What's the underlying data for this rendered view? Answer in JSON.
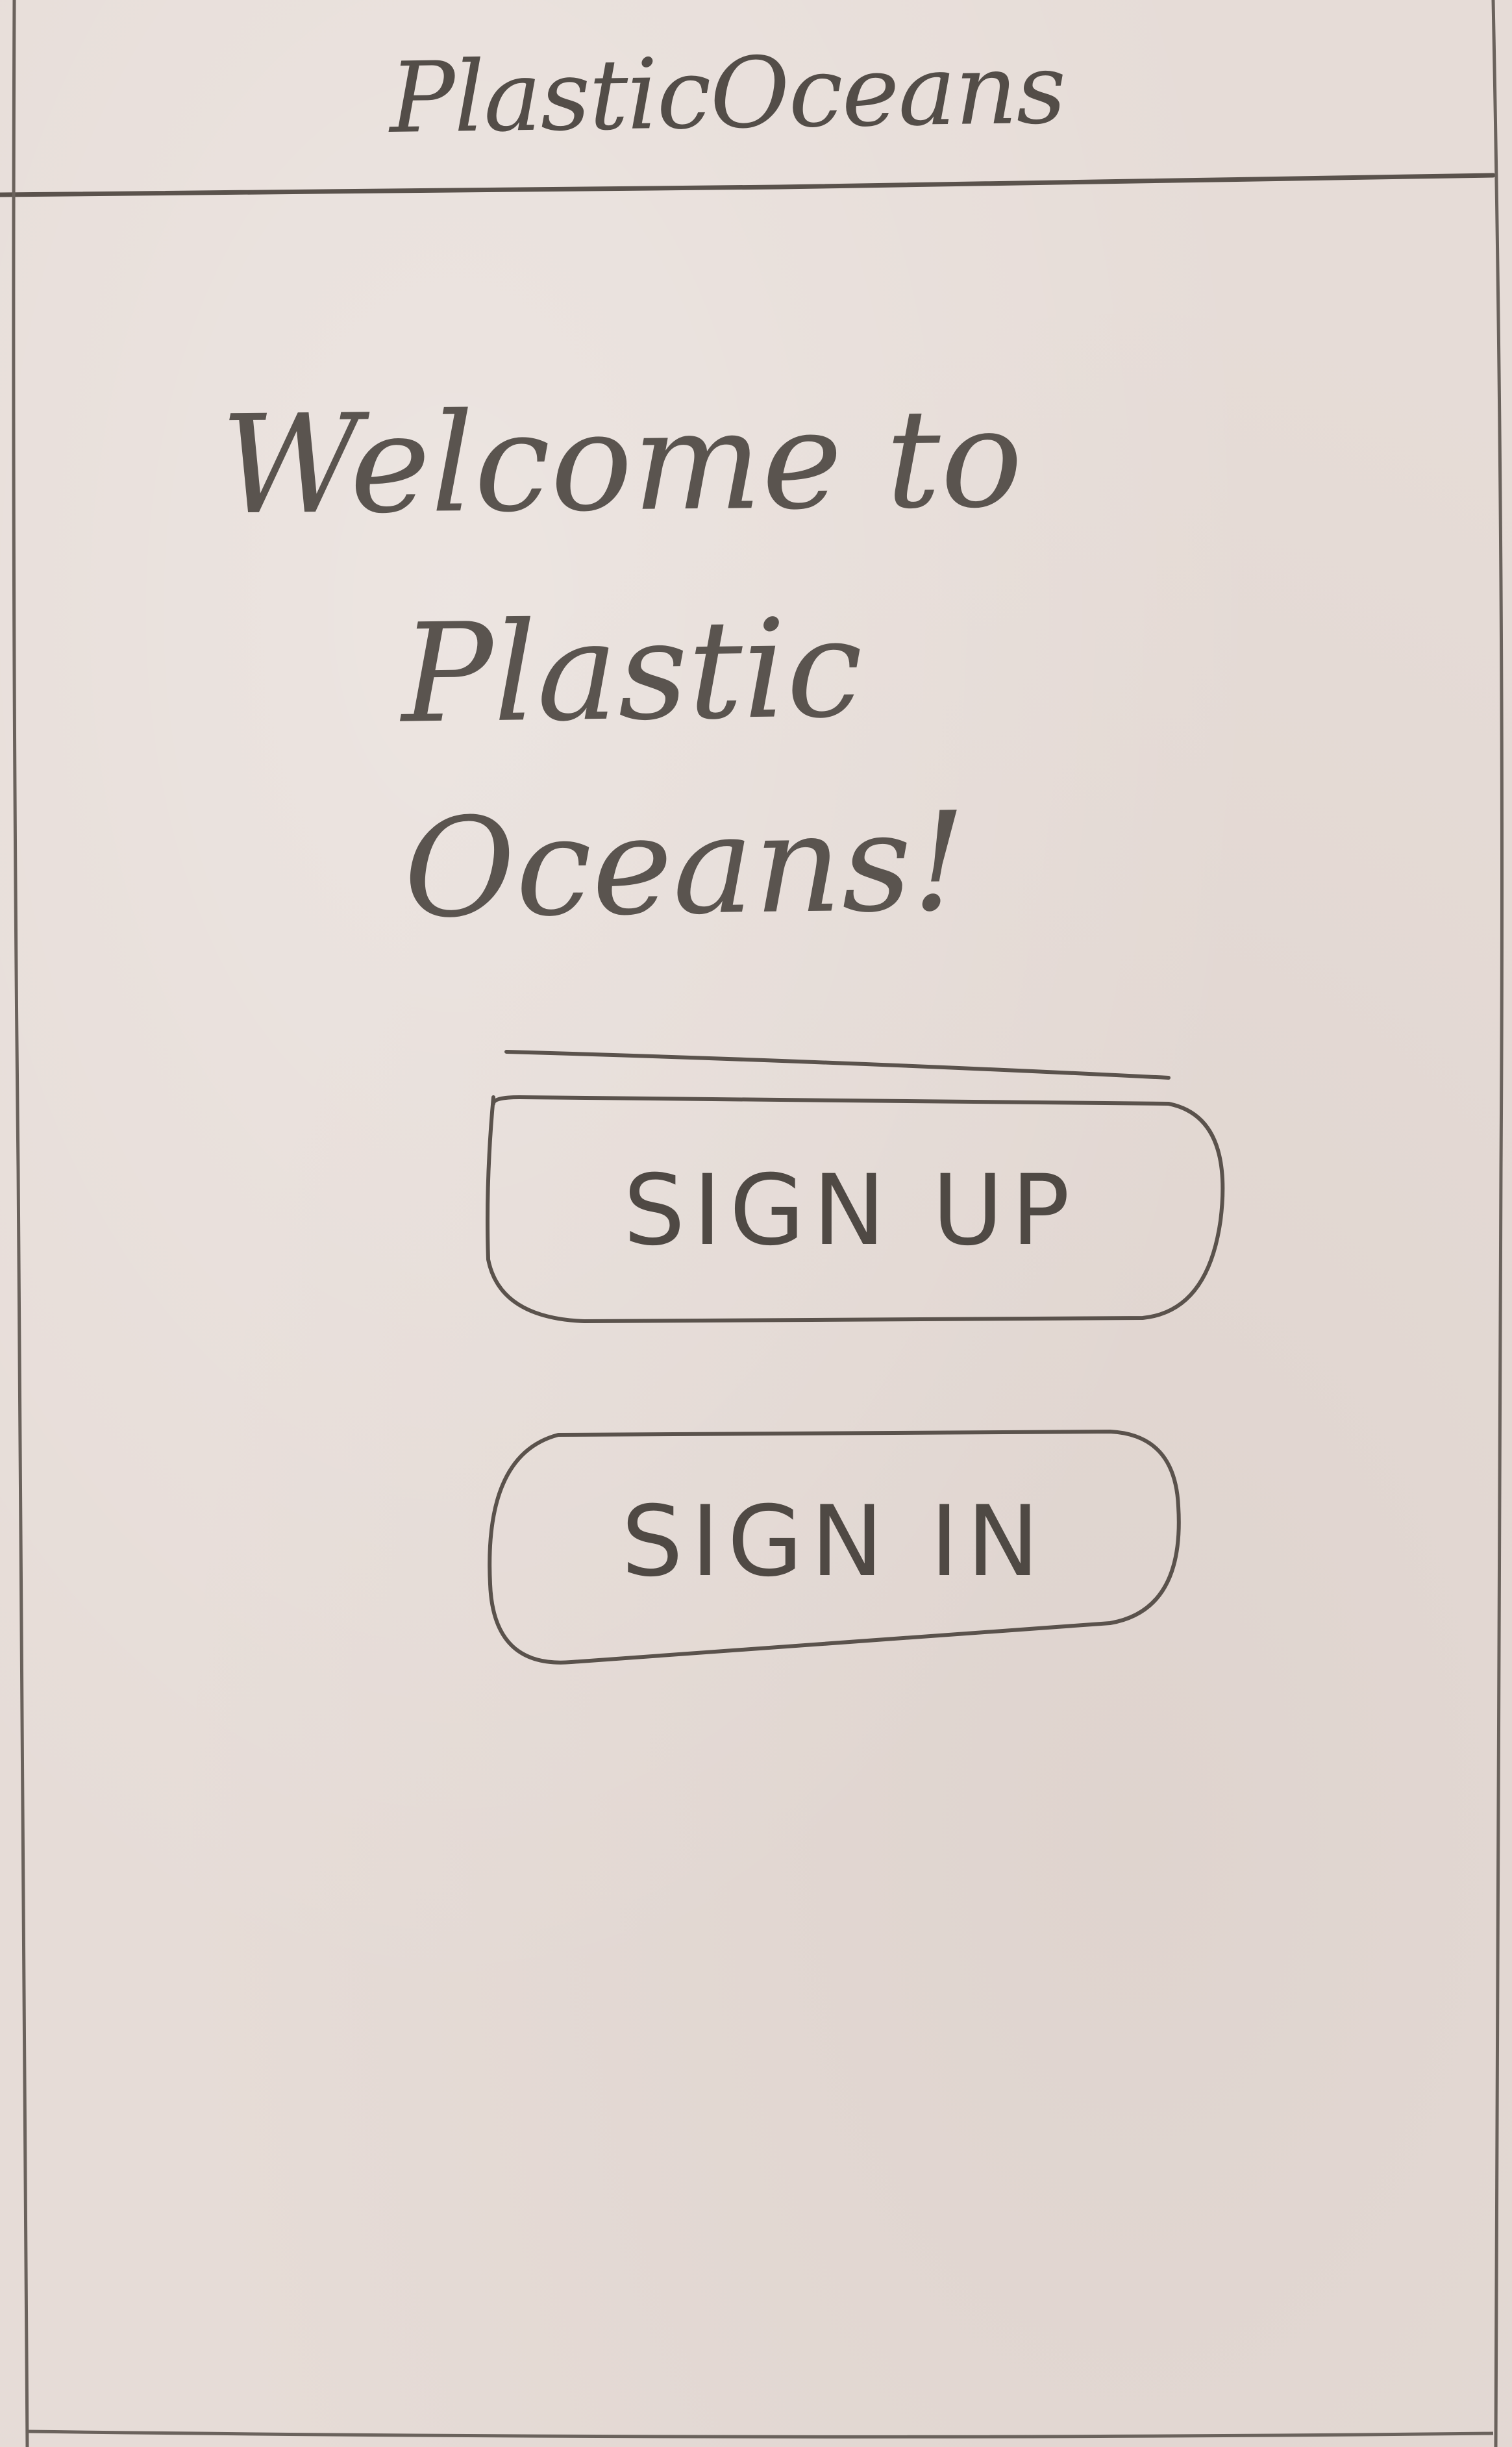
{
  "header": {
    "app_title": "PlasticOceans"
  },
  "main": {
    "welcome_line1": "Welcome to",
    "welcome_line2": "Plastic Oceans!"
  },
  "actions": {
    "sign_up_label": "SIGN UP",
    "sign_in_label": "SIGN IN"
  }
}
